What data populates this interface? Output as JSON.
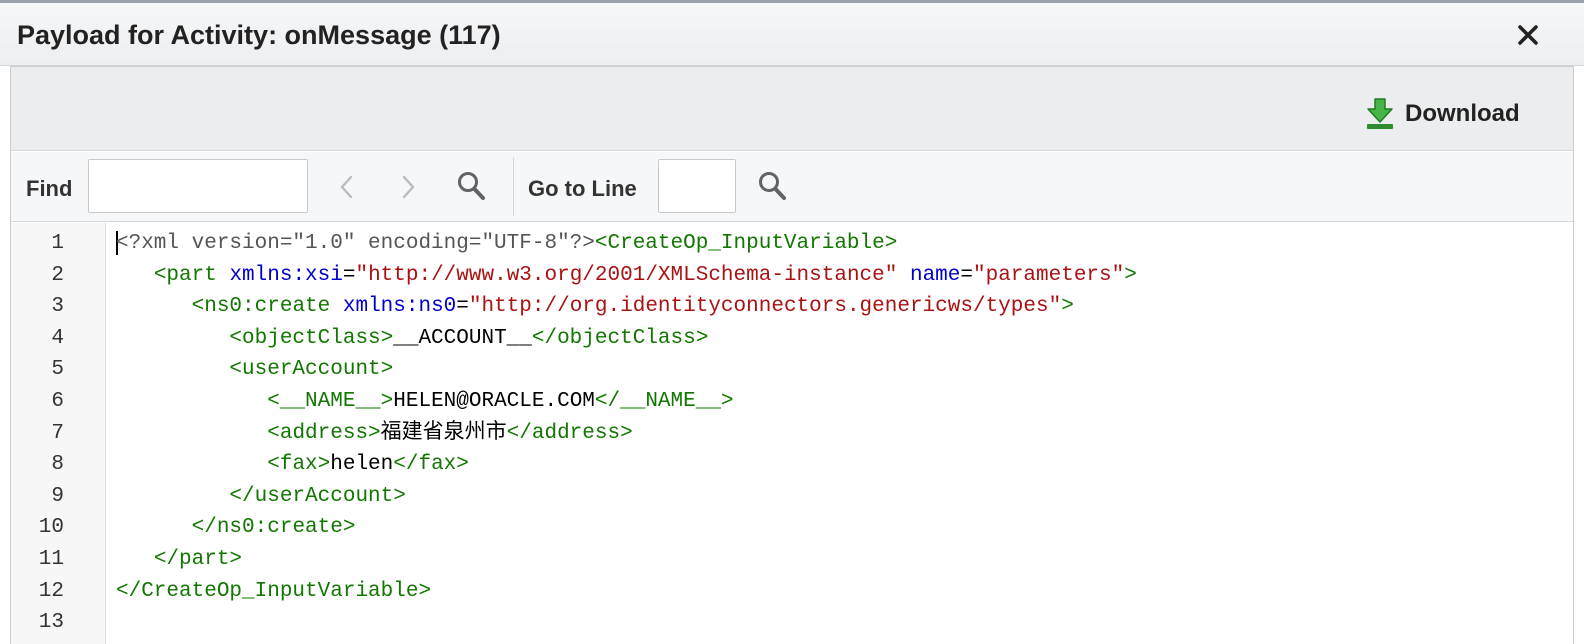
{
  "dialog": {
    "title": "Payload for Activity: onMessage (117)",
    "close_icon": "close-icon"
  },
  "toolbar": {
    "download_label": "Download",
    "download_icon": "download-arrow-icon",
    "download_icon_color": "#3aa13a"
  },
  "findbar": {
    "find_label": "Find",
    "find_value": "",
    "goto_label": "Go to Line",
    "goto_value": ""
  },
  "editor": {
    "line_numbers": [
      "1",
      "2",
      "3",
      "4",
      "5",
      "6",
      "7",
      "8",
      "9",
      "10",
      "11",
      "12",
      "13"
    ],
    "lines": [
      [
        [
          "meta",
          "<?xml version=\"1.0\" encoding=\"UTF-8\"?>"
        ],
        [
          "tag",
          "<CreateOp_InputVariable>"
        ]
      ],
      [
        [
          "txt",
          "   "
        ],
        [
          "tag",
          "<part "
        ],
        [
          "attr",
          "xmlns:xsi"
        ],
        [
          "txt",
          "="
        ],
        [
          "str",
          "\"http://www.w3.org/2001/XMLSchema-instance\""
        ],
        [
          "txt",
          " "
        ],
        [
          "attr",
          "name"
        ],
        [
          "txt",
          "="
        ],
        [
          "str",
          "\"parameters\""
        ],
        [
          "tag",
          ">"
        ]
      ],
      [
        [
          "txt",
          "      "
        ],
        [
          "tag",
          "<ns0:create "
        ],
        [
          "attr",
          "xmlns:ns0"
        ],
        [
          "txt",
          "="
        ],
        [
          "str",
          "\"http://org.identityconnectors.genericws/types\""
        ],
        [
          "tag",
          ">"
        ]
      ],
      [
        [
          "txt",
          "         "
        ],
        [
          "tag",
          "<objectClass>"
        ],
        [
          "txt",
          "__ACCOUNT__"
        ],
        [
          "tag",
          "</objectClass>"
        ]
      ],
      [
        [
          "txt",
          "         "
        ],
        [
          "tag",
          "<userAccount>"
        ]
      ],
      [
        [
          "txt",
          "            "
        ],
        [
          "tag",
          "<__NAME__>"
        ],
        [
          "txt",
          "HELEN@ORACLE.COM"
        ],
        [
          "tag",
          "</__NAME__>"
        ]
      ],
      [
        [
          "txt",
          "            "
        ],
        [
          "tag",
          "<address>"
        ],
        [
          "txt",
          "福建省泉州市"
        ],
        [
          "tag",
          "</address>"
        ]
      ],
      [
        [
          "txt",
          "            "
        ],
        [
          "tag",
          "<fax>"
        ],
        [
          "txt",
          "helen"
        ],
        [
          "tag",
          "</fax>"
        ]
      ],
      [
        [
          "txt",
          "         "
        ],
        [
          "tag",
          "</userAccount>"
        ]
      ],
      [
        [
          "txt",
          "      "
        ],
        [
          "tag",
          "</ns0:create>"
        ]
      ],
      [
        [
          "txt",
          "   "
        ],
        [
          "tag",
          "</part>"
        ]
      ],
      [
        [
          "tag",
          "</CreateOp_InputVariable>"
        ]
      ],
      []
    ],
    "colors": {
      "tag": "#117700",
      "meta": "#555555",
      "attribute": "#0000cc",
      "string": "#aa1111",
      "text": "#000000"
    }
  }
}
